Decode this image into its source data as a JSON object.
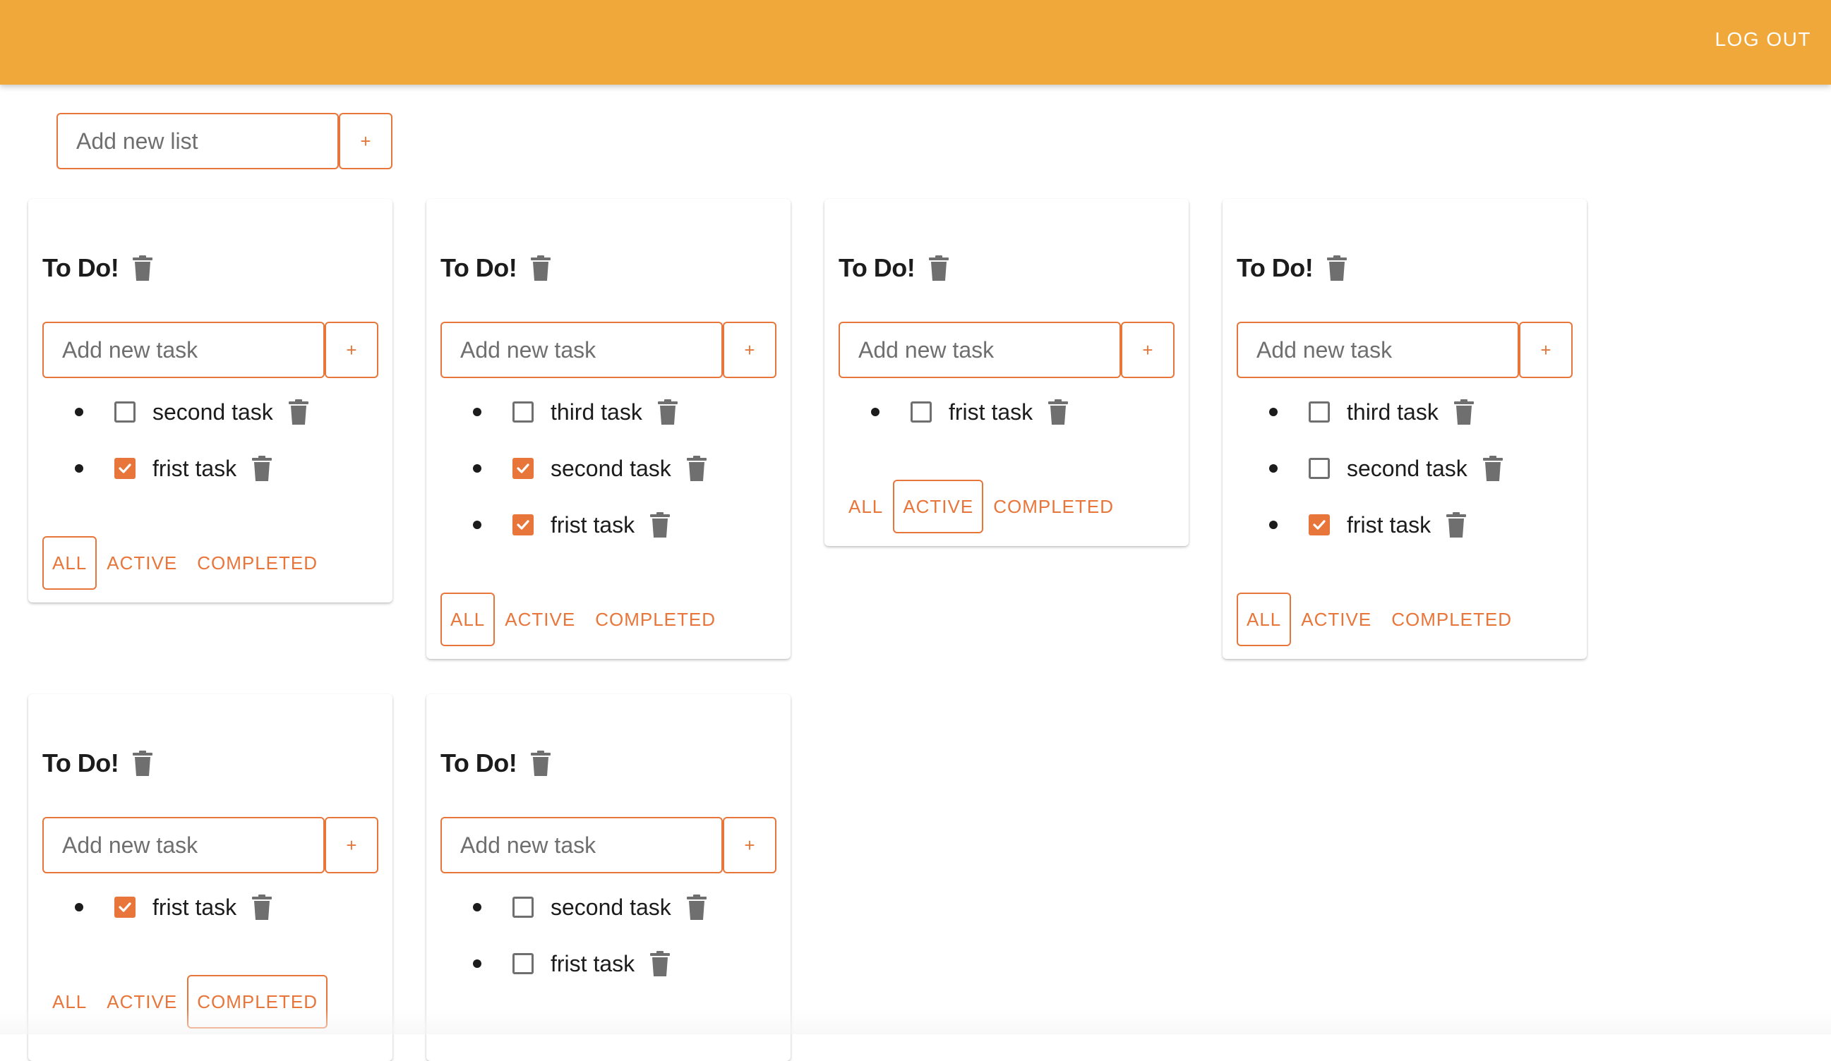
{
  "appbar": {
    "logout_label": "LOG OUT"
  },
  "add_list": {
    "placeholder": "Add new list",
    "button_label": "+"
  },
  "lists": [
    {
      "title": "To Do!",
      "input_placeholder": "Add new task",
      "add_label": "+",
      "tasks": [
        {
          "label": "second task",
          "checked": false
        },
        {
          "label": "frist task",
          "checked": true
        }
      ],
      "filters": [
        "ALL",
        "ACTIVE",
        "COMPLETED"
      ],
      "selected_filter": "ALL"
    },
    {
      "title": "To Do!",
      "input_placeholder": "Add new task",
      "add_label": "+",
      "tasks": [
        {
          "label": "third task",
          "checked": false
        },
        {
          "label": "second task",
          "checked": true
        },
        {
          "label": "frist task",
          "checked": true
        }
      ],
      "filters": [
        "ALL",
        "ACTIVE",
        "COMPLETED"
      ],
      "selected_filter": "ALL"
    },
    {
      "title": "To Do!",
      "input_placeholder": "Add new task",
      "add_label": "+",
      "tasks": [
        {
          "label": "frist task",
          "checked": false
        }
      ],
      "filters": [
        "ALL",
        "ACTIVE",
        "COMPLETED"
      ],
      "selected_filter": "ACTIVE"
    },
    {
      "title": "To Do!",
      "input_placeholder": "Add new task",
      "add_label": "+",
      "tasks": [
        {
          "label": "third task",
          "checked": false
        },
        {
          "label": "second task",
          "checked": false
        },
        {
          "label": "frist task",
          "checked": true
        }
      ],
      "filters": [
        "ALL",
        "ACTIVE",
        "COMPLETED"
      ],
      "selected_filter": "ALL"
    },
    {
      "title": "To Do!",
      "input_placeholder": "Add new task",
      "add_label": "+",
      "tasks": [
        {
          "label": "frist task",
          "checked": true
        }
      ],
      "filters": [
        "ALL",
        "ACTIVE",
        "COMPLETED"
      ],
      "selected_filter": "COMPLETED"
    },
    {
      "title": "To Do!",
      "input_placeholder": "Add new task",
      "add_label": "+",
      "tasks": [
        {
          "label": "second task",
          "checked": false
        },
        {
          "label": "frist task",
          "checked": false
        }
      ],
      "filters": [],
      "selected_filter": ""
    }
  ],
  "colors": {
    "appbar": "#f0a83a",
    "accent": "#e8763b",
    "icon_gray": "#6f6f6f",
    "text": "#1c1c1c"
  },
  "icons": {
    "delete": "trash-icon",
    "check": "check-icon"
  }
}
